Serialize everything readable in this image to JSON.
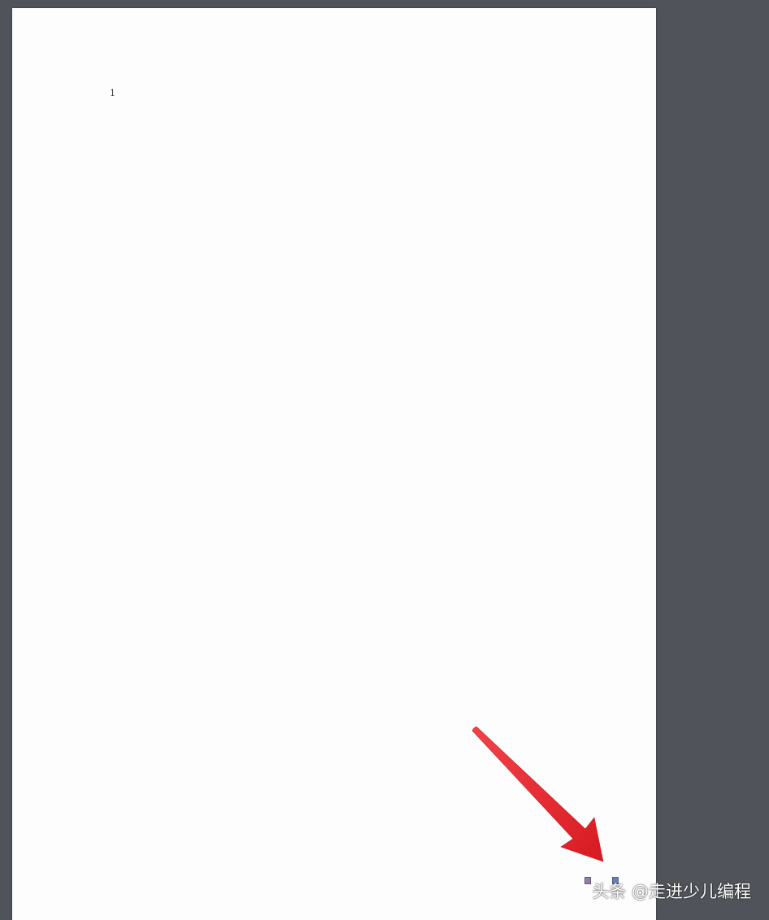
{
  "document": {
    "page_label": "1"
  },
  "annotation": {
    "arrow_color": "#e8242b",
    "arrow_icon": "arrow-pointer-icon"
  },
  "watermark": {
    "text": "头条 @走进少儿编程"
  },
  "colors": {
    "viewer_background": "#50545a",
    "page_background": "#fdfdfe"
  }
}
